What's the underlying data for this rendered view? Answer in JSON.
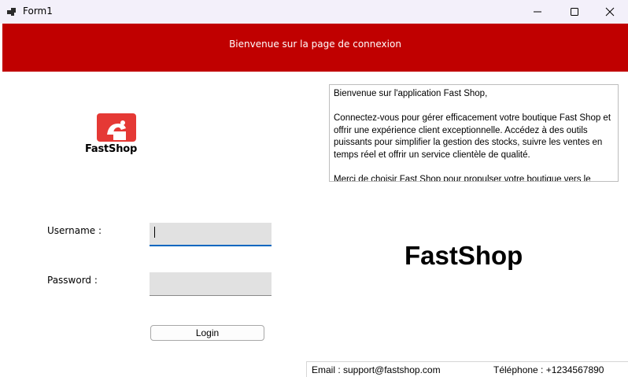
{
  "window": {
    "title": "Form1",
    "icons": [
      "app-icon",
      "minimize-icon",
      "maximize-icon",
      "close-icon"
    ]
  },
  "banner": {
    "text": "Bienvenue sur la page de connexion",
    "color": "#c00000"
  },
  "logo": {
    "brand_text": "FastShop",
    "icon": "shopping-bag-logo-icon",
    "accent": "#e53935"
  },
  "welcome": {
    "paragraphs": [
      "Bienvenue sur l'application Fast Shop,",
      "Connectez-vous pour gérer efficacement votre boutique Fast Shop et offrir une expérience client exceptionnelle. Accédez à des outils puissants pour simplifier la gestion des stocks, suivre les ventes en temps réel et offrir un service clientèle de qualité.",
      "Merci de choisir Fast Shop pour propulser votre boutique vers le"
    ]
  },
  "form": {
    "username_label": "Username :",
    "username_value": "",
    "password_label": "Password :",
    "password_value": "",
    "login_label": "Login"
  },
  "brand_title": "FastShop",
  "footer": {
    "email": "Email : support@fastshop.com",
    "phone": "Téléphone : +1234567890"
  }
}
